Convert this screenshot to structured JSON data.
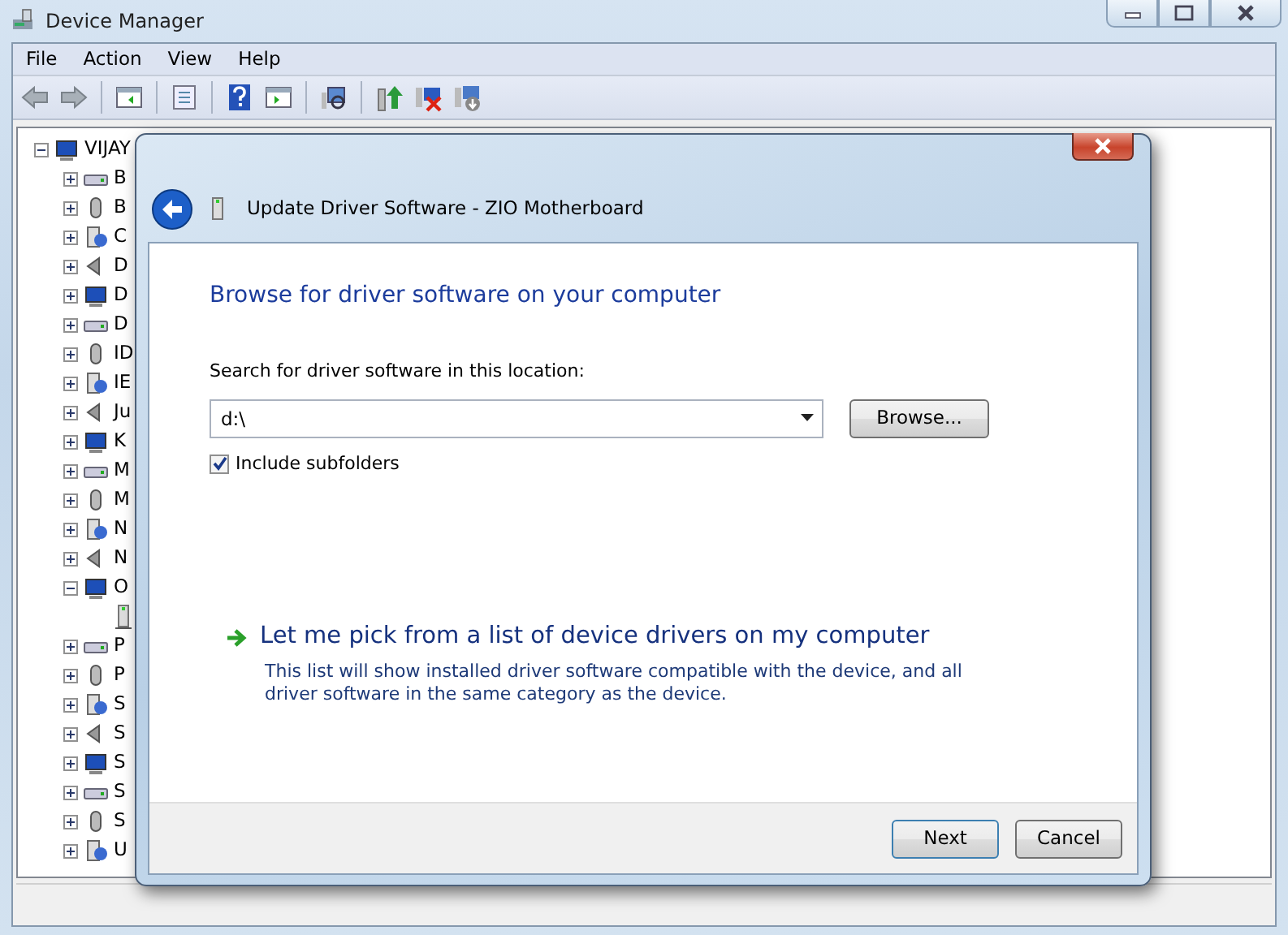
{
  "window": {
    "title": "Device Manager"
  },
  "menu": [
    "File",
    "Action",
    "View",
    "Help"
  ],
  "tree": {
    "label": "VIJAY",
    "expanded": true,
    "children": [
      {
        "label": "B",
        "expanded": false
      },
      {
        "label": "B",
        "expanded": false
      },
      {
        "label": "C",
        "expanded": false
      },
      {
        "label": "D",
        "expanded": false
      },
      {
        "label": "D",
        "expanded": false
      },
      {
        "label": "D",
        "expanded": false
      },
      {
        "label": "ID",
        "expanded": false
      },
      {
        "label": "IE",
        "expanded": false
      },
      {
        "label": "Ju",
        "expanded": false
      },
      {
        "label": "K",
        "expanded": false
      },
      {
        "label": "M",
        "expanded": false
      },
      {
        "label": "M",
        "expanded": false
      },
      {
        "label": "N",
        "expanded": false
      },
      {
        "label": "N",
        "expanded": false
      },
      {
        "label": "O",
        "expanded": true,
        "children": [
          {
            "kind": "device"
          }
        ]
      },
      {
        "label": "P",
        "expanded": false
      },
      {
        "label": "P",
        "expanded": false
      },
      {
        "label": "S",
        "expanded": false
      },
      {
        "label": "S",
        "expanded": false
      },
      {
        "label": "S",
        "expanded": false
      },
      {
        "label": "S",
        "expanded": false
      },
      {
        "label": "S",
        "expanded": false
      },
      {
        "label": "U",
        "expanded": false
      }
    ]
  },
  "dialog": {
    "title": "Update Driver Software - ZIO Motherboard",
    "heading": "Browse for driver software on your computer",
    "search_label": "Search for driver software in this location:",
    "location": "d:\\",
    "browse_button": "Browse...",
    "include_subfolders": {
      "label": "Include subfolders",
      "checked": true
    },
    "pick_link": "Let me pick from a list of device drivers on my computer",
    "pick_description": "This list will show installed driver software compatible with the device, and all driver software in the same category as the device.",
    "buttons": [
      "Next",
      "Cancel"
    ]
  }
}
